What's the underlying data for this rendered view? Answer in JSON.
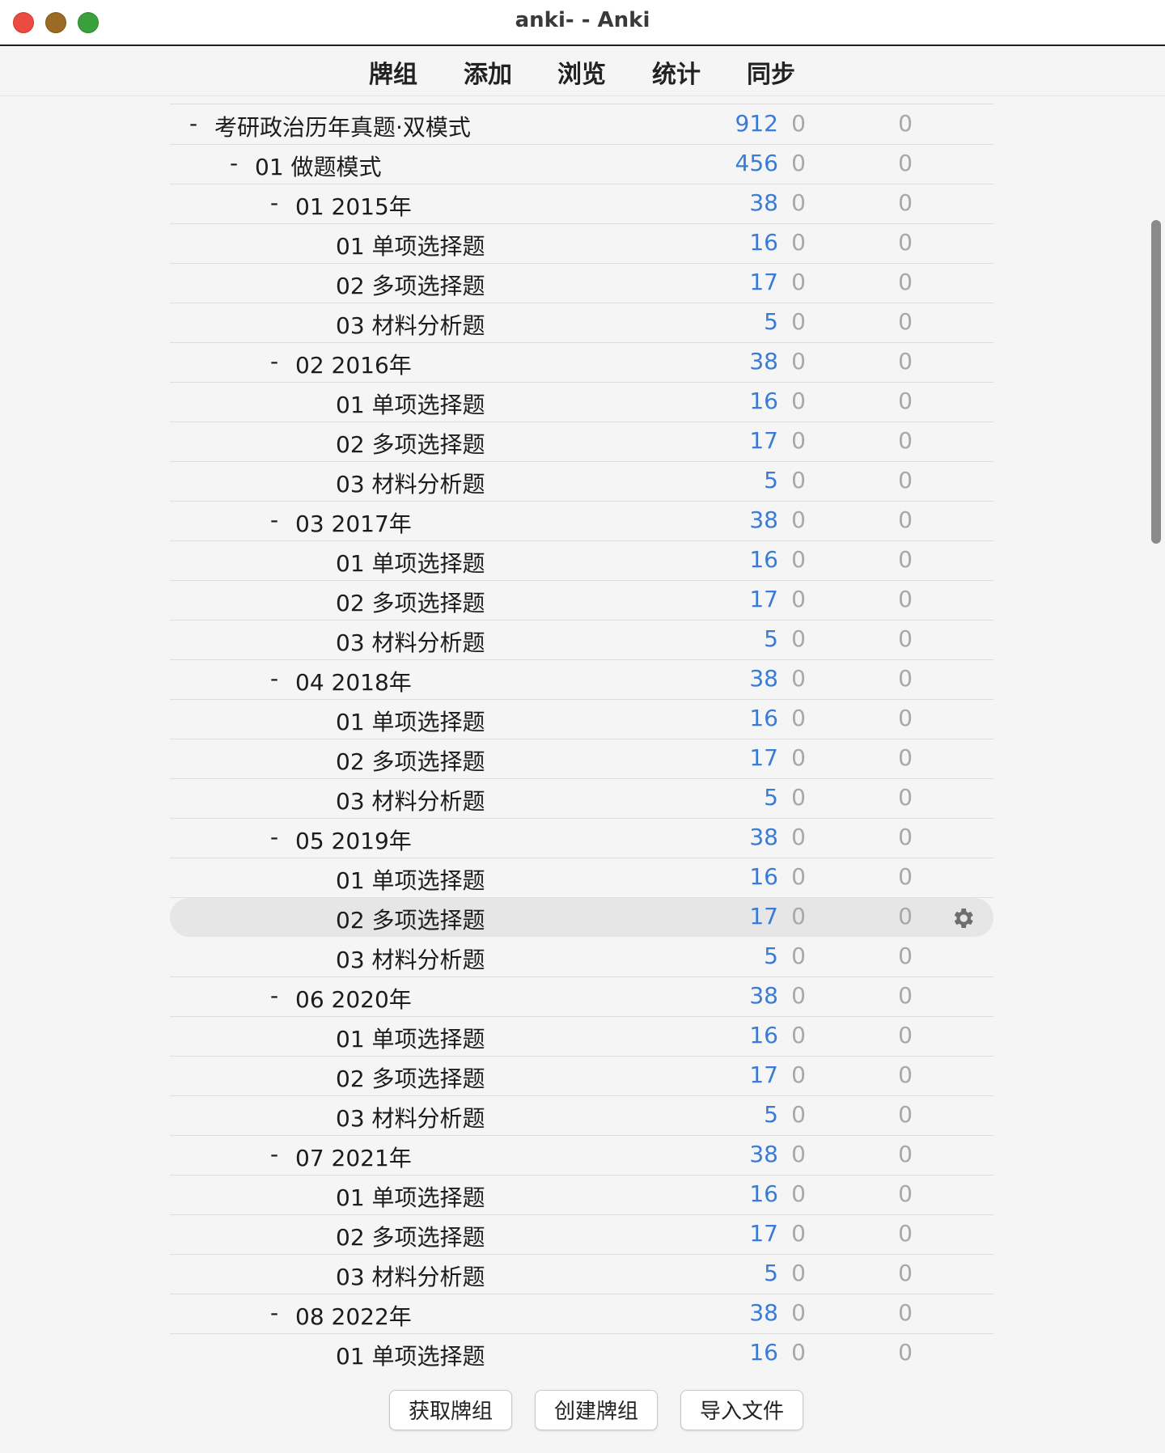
{
  "window": {
    "title": "anki- - Anki",
    "traffic_colors": {
      "close": "#ec4b41",
      "minimize": "#9b6a24",
      "maximize": "#3aa03c"
    }
  },
  "toolbar": {
    "items": [
      "牌组",
      "添加",
      "浏览",
      "统计",
      "同步"
    ]
  },
  "deck_rows": [
    {
      "name": "考研政治历年真题·双模式",
      "collapse": "-",
      "level": 0,
      "new": "912",
      "learn": "0",
      "due": "0"
    },
    {
      "name": "01 做题模式",
      "collapse": "-",
      "level": 1,
      "new": "456",
      "learn": "0",
      "due": "0"
    },
    {
      "name": "01 2015年",
      "collapse": "-",
      "level": 2,
      "new": "38",
      "learn": "0",
      "due": "0"
    },
    {
      "name": "01 单项选择题",
      "collapse": "",
      "level": 3,
      "new": "16",
      "learn": "0",
      "due": "0"
    },
    {
      "name": "02 多项选择题",
      "collapse": "",
      "level": 3,
      "new": "17",
      "learn": "0",
      "due": "0"
    },
    {
      "name": "03 材料分析题",
      "collapse": "",
      "level": 3,
      "new": "5",
      "learn": "0",
      "due": "0"
    },
    {
      "name": "02 2016年",
      "collapse": "-",
      "level": 2,
      "new": "38",
      "learn": "0",
      "due": "0"
    },
    {
      "name": "01 单项选择题",
      "collapse": "",
      "level": 3,
      "new": "16",
      "learn": "0",
      "due": "0"
    },
    {
      "name": "02 多项选择题",
      "collapse": "",
      "level": 3,
      "new": "17",
      "learn": "0",
      "due": "0"
    },
    {
      "name": "03 材料分析题",
      "collapse": "",
      "level": 3,
      "new": "5",
      "learn": "0",
      "due": "0"
    },
    {
      "name": "03 2017年",
      "collapse": "-",
      "level": 2,
      "new": "38",
      "learn": "0",
      "due": "0"
    },
    {
      "name": "01 单项选择题",
      "collapse": "",
      "level": 3,
      "new": "16",
      "learn": "0",
      "due": "0"
    },
    {
      "name": "02 多项选择题",
      "collapse": "",
      "level": 3,
      "new": "17",
      "learn": "0",
      "due": "0"
    },
    {
      "name": "03 材料分析题",
      "collapse": "",
      "level": 3,
      "new": "5",
      "learn": "0",
      "due": "0"
    },
    {
      "name": "04 2018年",
      "collapse": "-",
      "level": 2,
      "new": "38",
      "learn": "0",
      "due": "0"
    },
    {
      "name": "01 单项选择题",
      "collapse": "",
      "level": 3,
      "new": "16",
      "learn": "0",
      "due": "0"
    },
    {
      "name": "02 多项选择题",
      "collapse": "",
      "level": 3,
      "new": "17",
      "learn": "0",
      "due": "0"
    },
    {
      "name": "03 材料分析题",
      "collapse": "",
      "level": 3,
      "new": "5",
      "learn": "0",
      "due": "0"
    },
    {
      "name": "05 2019年",
      "collapse": "-",
      "level": 2,
      "new": "38",
      "learn": "0",
      "due": "0"
    },
    {
      "name": "01 单项选择题",
      "collapse": "",
      "level": 3,
      "new": "16",
      "learn": "0",
      "due": "0"
    },
    {
      "name": "02 多项选择题",
      "collapse": "",
      "level": 3,
      "new": "17",
      "learn": "0",
      "due": "0",
      "selected": true
    },
    {
      "name": "03 材料分析题",
      "collapse": "",
      "level": 3,
      "new": "5",
      "learn": "0",
      "due": "0"
    },
    {
      "name": "06 2020年",
      "collapse": "-",
      "level": 2,
      "new": "38",
      "learn": "0",
      "due": "0"
    },
    {
      "name": "01 单项选择题",
      "collapse": "",
      "level": 3,
      "new": "16",
      "learn": "0",
      "due": "0"
    },
    {
      "name": "02 多项选择题",
      "collapse": "",
      "level": 3,
      "new": "17",
      "learn": "0",
      "due": "0"
    },
    {
      "name": "03 材料分析题",
      "collapse": "",
      "level": 3,
      "new": "5",
      "learn": "0",
      "due": "0"
    },
    {
      "name": "07 2021年",
      "collapse": "-",
      "level": 2,
      "new": "38",
      "learn": "0",
      "due": "0"
    },
    {
      "name": "01 单项选择题",
      "collapse": "",
      "level": 3,
      "new": "16",
      "learn": "0",
      "due": "0"
    },
    {
      "name": "02 多项选择题",
      "collapse": "",
      "level": 3,
      "new": "17",
      "learn": "0",
      "due": "0"
    },
    {
      "name": "03 材料分析题",
      "collapse": "",
      "level": 3,
      "new": "5",
      "learn": "0",
      "due": "0"
    },
    {
      "name": "08 2022年",
      "collapse": "-",
      "level": 2,
      "new": "38",
      "learn": "0",
      "due": "0"
    },
    {
      "name": "01 单项选择题",
      "collapse": "",
      "level": 3,
      "new": "16",
      "learn": "0",
      "due": "0"
    }
  ],
  "colors": {
    "new_count": "#3a7bd5",
    "zero_count": "#a8a8a8",
    "selected_row": "#e6e6e6"
  },
  "bottom_buttons": {
    "get_shared": "获取牌组",
    "create_deck": "创建牌组",
    "import_file": "导入文件"
  }
}
